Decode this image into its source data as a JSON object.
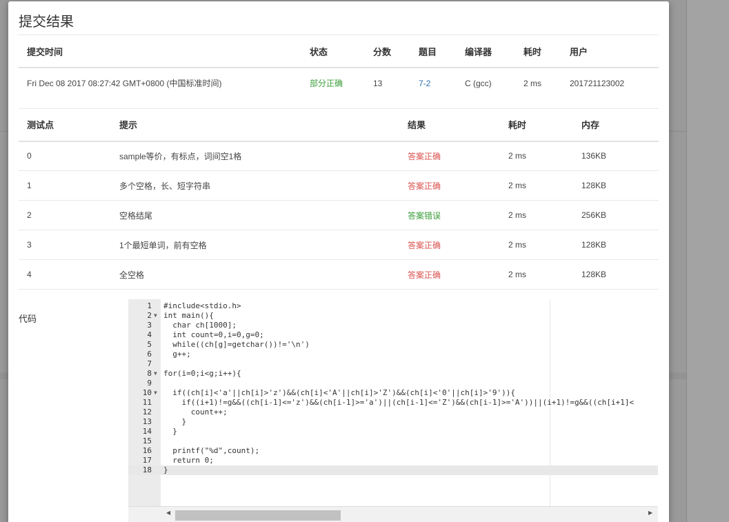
{
  "dialog": {
    "title": "提交结果",
    "code_label": "代码"
  },
  "summary": {
    "headers": [
      "提交时间",
      "状态",
      "分数",
      "题目",
      "编译器",
      "耗时",
      "用户"
    ],
    "row": {
      "time": "Fri Dec 08 2017 08:27:42 GMT+0800 (中国标准时间)",
      "status": "部分正确",
      "score": "13",
      "problem": "7-2",
      "compiler": "C (gcc)",
      "duration": "2 ms",
      "user": "201721123002"
    }
  },
  "tests": {
    "headers": [
      "测试点",
      "提示",
      "结果",
      "耗时",
      "内存"
    ],
    "rows": [
      {
        "id": "0",
        "hint": "sample等价，有标点，词间空1格",
        "result": "答案正确",
        "time": "2 ms",
        "memory": "136KB"
      },
      {
        "id": "1",
        "hint": "多个空格，长、短字符串",
        "result": "答案正确",
        "time": "2 ms",
        "memory": "128KB"
      },
      {
        "id": "2",
        "hint": "空格结尾",
        "result": "答案错误",
        "time": "2 ms",
        "memory": "256KB"
      },
      {
        "id": "3",
        "hint": "1个最短单词，前有空格",
        "result": "答案正确",
        "time": "2 ms",
        "memory": "128KB"
      },
      {
        "id": "4",
        "hint": "全空格",
        "result": "答案正确",
        "time": "2 ms",
        "memory": "128KB"
      }
    ]
  },
  "code": {
    "lines": [
      "#include<stdio.h>",
      "int main(){",
      "  char ch[1000];",
      "  int count=0,i=0,g=0;",
      "  while((ch[g]=getchar())!='\\n')",
      "  g++;",
      "",
      "for(i=0;i<g;i++){",
      "",
      "  if((ch[i]<'a'||ch[i]>'z')&&(ch[i]<'A'||ch[i]>'Z')&&(ch[i]<'0'||ch[i]>'9')){",
      "    if((i+1)!=g&&((ch[i-1]<='z')&&(ch[i-1]>='a')||(ch[i-1]<='Z')&&(ch[i-1]>='A'))||(i+1)!=g&&((ch[i+1]<",
      "      count++;",
      "    }",
      "  }",
      "",
      "  printf(\"%d\",count);",
      "  return 0;",
      "}"
    ],
    "fold_lines": [
      2,
      8,
      10
    ],
    "active_line": 18
  },
  "colors": {
    "correct": "#d9534f",
    "wrong": "#3a9d3a",
    "partial": "#3a9d3a",
    "link": "#2a6fb5"
  }
}
